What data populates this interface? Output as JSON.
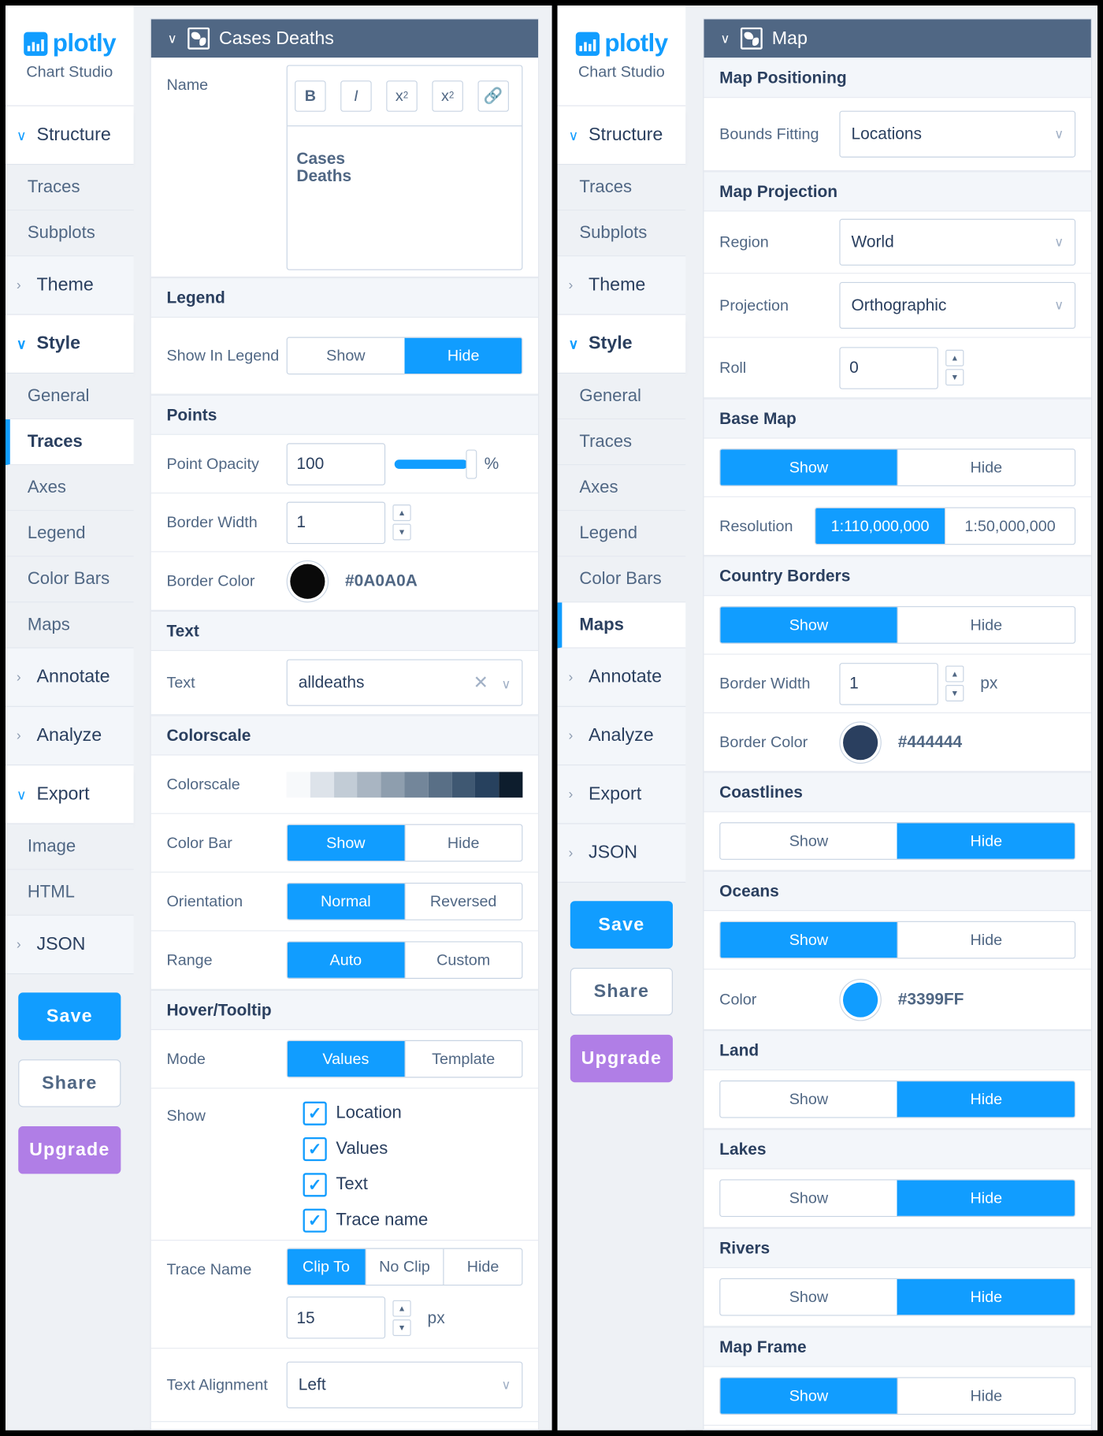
{
  "logo": {
    "word": "plotly",
    "sub": "Chart Studio"
  },
  "left_screen": {
    "sidebar": {
      "structure": "Structure",
      "structure_items": [
        "Traces",
        "Subplots"
      ],
      "theme": "Theme",
      "style": "Style",
      "style_items": [
        "General",
        "Traces",
        "Axes",
        "Legend",
        "Color Bars",
        "Maps"
      ],
      "annotate": "Annotate",
      "analyze": "Analyze",
      "export": "Export",
      "export_items": [
        "Image",
        "HTML"
      ],
      "json": "JSON",
      "save": "Save",
      "share": "Share",
      "upgrade": "Upgrade"
    },
    "panel": {
      "title": "Cases Deaths",
      "name_label": "Name",
      "toolbar": {
        "bold": "B",
        "italic": "I",
        "sub": "x",
        "sub_mark": "2",
        "sup": "x",
        "sup_mark": "2",
        "link": "🔗"
      },
      "name_text_1": "Cases",
      "name_text_2": "Deaths",
      "legend_section": "Legend",
      "show_in_legend": "Show In Legend",
      "show": "Show",
      "hide": "Hide",
      "points_section": "Points",
      "point_opacity": "Point Opacity",
      "point_opacity_value": "100",
      "percent": "%",
      "border_width": "Border Width",
      "border_width_value": "1",
      "border_color": "Border Color",
      "border_color_hex": "#0A0A0A",
      "text_section": "Text",
      "text_label": "Text",
      "text_value": "alldeaths",
      "colorscale_section": "Colorscale",
      "colorscale_label": "Colorscale",
      "colorscale_colors": [
        "#f7f9fb",
        "#dde3ea",
        "#c2ccd6",
        "#a9b5c2",
        "#8e9eae",
        "#73869a",
        "#596f86",
        "#3f5872",
        "#27415e",
        "#0d1d2d"
      ],
      "color_bar": "Color Bar",
      "orientation": "Orientation",
      "normal": "Normal",
      "reversed": "Reversed",
      "range": "Range",
      "auto": "Auto",
      "custom": "Custom",
      "hover_section": "Hover/Tooltip",
      "mode": "Mode",
      "values_opt": "Values",
      "template_opt": "Template",
      "show_label": "Show",
      "checks": [
        "Location",
        "Values",
        "Text",
        "Trace name"
      ],
      "trace_name": "Trace Name",
      "clip_to": "Clip To",
      "no_clip": "No Clip",
      "trace_len": "15",
      "px": "px",
      "text_alignment": "Text Alignment",
      "alignment_value": "Left"
    }
  },
  "right_screen": {
    "sidebar": {
      "structure": "Structure",
      "structure_items": [
        "Traces",
        "Subplots"
      ],
      "theme": "Theme",
      "style": "Style",
      "style_items": [
        "General",
        "Traces",
        "Axes",
        "Legend",
        "Color Bars",
        "Maps"
      ],
      "annotate": "Annotate",
      "analyze": "Analyze",
      "export": "Export",
      "json": "JSON",
      "save": "Save",
      "share": "Share",
      "upgrade": "Upgrade"
    },
    "panel": {
      "title": "Map",
      "map_positioning": "Map Positioning",
      "bounds_fitting": "Bounds Fitting",
      "bounds_value": "Locations",
      "map_projection": "Map Projection",
      "region": "Region",
      "region_value": "World",
      "projection": "Projection",
      "projection_value": "Orthographic",
      "roll": "Roll",
      "roll_value": "0",
      "base_map": "Base Map",
      "show": "Show",
      "hide": "Hide",
      "resolution": "Resolution",
      "res_1": "1:110,000,000",
      "res_2": "1:50,000,000",
      "country_borders": "Country Borders",
      "border_width": "Border Width",
      "border_width_value": "1",
      "px": "px",
      "border_color": "Border Color",
      "border_color_hex": "#444444",
      "coastlines": "Coastlines",
      "oceans": "Oceans",
      "color": "Color",
      "ocean_color_hex": "#3399FF",
      "land": "Land",
      "lakes": "Lakes",
      "rivers": "Rivers",
      "map_frame": "Map Frame"
    }
  }
}
